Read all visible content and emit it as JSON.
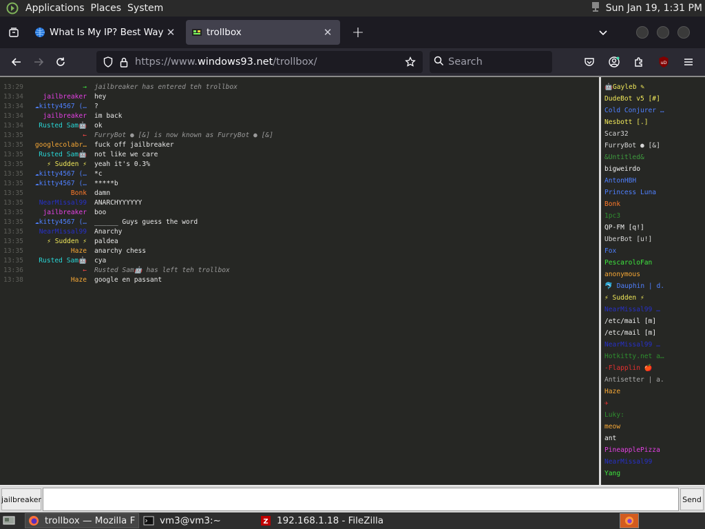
{
  "panel": {
    "menus": [
      "Applications",
      "Places",
      "System"
    ],
    "clock": "Sun Jan 19,  1:31 PM"
  },
  "browser": {
    "tabs": [
      {
        "title": "What Is My IP? Best Way To",
        "active": false
      },
      {
        "title": "trollbox",
        "active": true
      }
    ],
    "url": {
      "prefix": "https://www.",
      "domain": "windows93.net",
      "path": "/trollbox/"
    },
    "search_placeholder": "Search"
  },
  "chat": {
    "messages": [
      {
        "time": "13:29",
        "nick": "→",
        "nick_color": "#3ee63e",
        "text": "jailbreaker has entered teh trollbox",
        "system": true
      },
      {
        "time": "13:34",
        "nick": "jailbreaker",
        "nick_color": "#e341e3",
        "text": "hey"
      },
      {
        "time": "13:34",
        "nick": "☁kitty4567 (…",
        "nick_color": "#4f80ff",
        "text": "?"
      },
      {
        "time": "13:34",
        "nick": "jailbreaker",
        "nick_color": "#e341e3",
        "text": "im back"
      },
      {
        "time": "13:34",
        "nick": "Rusted Sam🤖",
        "nick_color": "#29d6d6",
        "text": "ok"
      },
      {
        "time": "13:35",
        "nick": "←",
        "nick_color": "#ff4a4a",
        "text": "FurryBot ● [&] is now known as FurryBot ● [&]",
        "system": true
      },
      {
        "time": "13:35",
        "nick": "googlecolabr…",
        "nick_color": "#f7a836",
        "text": "fuck off jailbreaker"
      },
      {
        "time": "13:35",
        "nick": "Rusted Sam🤖",
        "nick_color": "#29d6d6",
        "text": "not like we care"
      },
      {
        "time": "13:35",
        "nick": "⚡ Sudden ⚡",
        "nick_color": "#f0e85a",
        "text": "yeah it's 0.3%"
      },
      {
        "time": "13:35",
        "nick": "☁kitty4567 (…",
        "nick_color": "#4f80ff",
        "text": "*c"
      },
      {
        "time": "13:35",
        "nick": "☁kitty4567 (…",
        "nick_color": "#4f80ff",
        "text": "*****b"
      },
      {
        "time": "13:35",
        "nick": "Bonk",
        "nick_color": "#ff7a2a",
        "text": "damn"
      },
      {
        "time": "13:35",
        "nick": "NearMissal99",
        "nick_color": "#2730c8",
        "text": "ANARCHYYYYYY"
      },
      {
        "time": "13:35",
        "nick": "jailbreaker",
        "nick_color": "#e341e3",
        "text": "boo"
      },
      {
        "time": "13:35",
        "nick": "☁kitty4567 (…",
        "nick_color": "#4f80ff",
        "text": "______ Guys guess the word"
      },
      {
        "time": "13:35",
        "nick": "NearMissal99",
        "nick_color": "#2730c8",
        "text": "Anarchy"
      },
      {
        "time": "13:35",
        "nick": "⚡ Sudden ⚡",
        "nick_color": "#f0e85a",
        "text": "paldea"
      },
      {
        "time": "13:35",
        "nick": "Haze",
        "nick_color": "#f7a836",
        "text": "anarchy chess"
      },
      {
        "time": "13:35",
        "nick": "Rusted Sam🤖",
        "nick_color": "#29d6d6",
        "text": "cya"
      },
      {
        "time": "13:36",
        "nick": "←",
        "nick_color": "#ff4a4a",
        "text": "Rusted Sam🤖 has left teh trollbox",
        "system": true
      },
      {
        "time": "13:38",
        "nick": "Haze",
        "nick_color": "#f7a836",
        "text": "google en passant"
      }
    ],
    "users": [
      {
        "name": "🤖Gayleb ✎",
        "color": "#f0e85a"
      },
      {
        "name": "DudeBot v5 [#]",
        "color": "#f0e85a"
      },
      {
        "name": "Cold Conjurer …",
        "color": "#4f80ff"
      },
      {
        "name": "Nesbott [.]",
        "color": "#f0e85a"
      },
      {
        "name": "Scar32",
        "color": "#d6d6d6"
      },
      {
        "name": "FurryBot ● [&]",
        "color": "#d6d6d6"
      },
      {
        "name": "&Untitled&",
        "color": "#3e9b3e"
      },
      {
        "name": "bigweirdo",
        "color": "#f0f0f0"
      },
      {
        "name": "AntonHBH",
        "color": "#4f80ff"
      },
      {
        "name": "Princess Luna",
        "color": "#4f80ff"
      },
      {
        "name": "Bonk",
        "color": "#ff7a2a"
      },
      {
        "name": "1pc3",
        "color": "#2f8f2f"
      },
      {
        "name": "QP-FM [q!]",
        "color": "#f0f0f0"
      },
      {
        "name": "UberBot [u!]",
        "color": "#d6d6d6"
      },
      {
        "name": "Fox",
        "color": "#4f80ff"
      },
      {
        "name": "PescaroloFan",
        "color": "#3ee63e"
      },
      {
        "name": "anonymous",
        "color": "#f7a836"
      },
      {
        "name": "🐬 Dauphin | d.",
        "color": "#4f80ff"
      },
      {
        "name": "⚡ Sudden ⚡",
        "color": "#f0e85a"
      },
      {
        "name": "NearMissal99 …",
        "color": "#2730c8"
      },
      {
        "name": "/etc/mail [m]",
        "color": "#f0f0f0"
      },
      {
        "name": "/etc/mail [m]",
        "color": "#f0f0f0"
      },
      {
        "name": "NearMissal99 …",
        "color": "#2730c8"
      },
      {
        "name": "Hotkitty.net a…",
        "color": "#2f8f2f"
      },
      {
        "name": "-Flapplin 🍎",
        "color": "#e63030"
      },
      {
        "name": "Antisetter | a.",
        "color": "#aaaaaa"
      },
      {
        "name": "Haze",
        "color": "#f7a836"
      },
      {
        "name": "✈",
        "color": "#e63030"
      },
      {
        "name": "Luky:",
        "color": "#2f8f2f"
      },
      {
        "name": "meow",
        "color": "#f7a836"
      },
      {
        "name": "ant",
        "color": "#f0f0f0"
      },
      {
        "name": "PineapplePizza",
        "color": "#e341e3"
      },
      {
        "name": "NearMissal99",
        "color": "#2730c8"
      },
      {
        "name": "Yang",
        "color": "#3ee63e"
      }
    ],
    "nick_button": "jailbreaker",
    "send_button": "Send",
    "input_value": ""
  },
  "taskbar": {
    "tasks": [
      "trollbox — Mozilla F…",
      "vm3@vm3:~",
      "192.168.1.18 - FileZilla"
    ]
  },
  "colors": {
    "chat_bg": "#262724",
    "timestamp": "#5e5f5a",
    "browser_toolbar": "#2b2a33",
    "tab_bar": "#1c1b22"
  }
}
